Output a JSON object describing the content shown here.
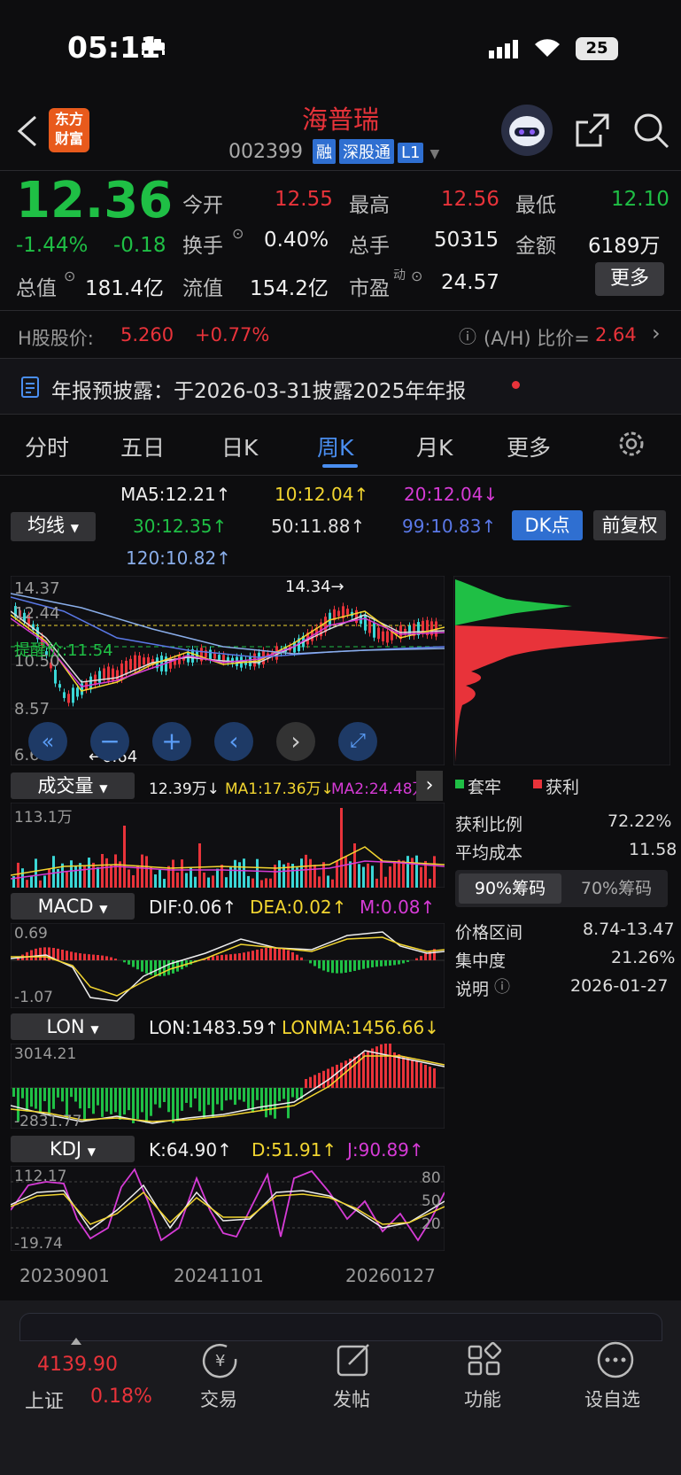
{
  "status": {
    "time": "05:11",
    "battery": "25"
  },
  "header": {
    "title": "海普瑞",
    "code": "002399",
    "tags": [
      "融",
      "深股通",
      "L1"
    ],
    "logo_text_1": "东方",
    "logo_text_2": "财富"
  },
  "quote": {
    "price": "12.36",
    "change_pct": "-1.44%",
    "change": "-0.18",
    "open_label": "今开",
    "open": "12.55",
    "high_label": "最高",
    "high": "12.56",
    "low_label": "最低",
    "low": "12.10",
    "turnover_label": "换手",
    "turnover": "0.40%",
    "volume_label": "总手",
    "volume": "50315",
    "amount_label": "金额",
    "amount": "6189万",
    "mktcap_label": "总值",
    "mktcap": "181.4亿",
    "float_label": "流值",
    "float": "154.2亿",
    "pe_label": "市盈",
    "pe_sup": "动",
    "pe": "24.57",
    "more": "更多"
  },
  "hshare": {
    "label": "H股股价:",
    "price": "5.260",
    "change": "+0.77%",
    "ratio_label": "(A/H) 比价=",
    "ratio": "2.64"
  },
  "notice": {
    "text": "年报预披露：于2026-03-31披露2025年年报"
  },
  "tabs": [
    "分时",
    "五日",
    "日K",
    "周K",
    "月K",
    "更多"
  ],
  "ma": {
    "ma5": "MA5:12.21↑",
    "ma10": "10:12.04↑",
    "ma20": "20:12.04↓",
    "ma30": "30:12.35↑",
    "ma50": "50:11.88↑",
    "ma99": "99:10.83↑",
    "ma120": "120:10.82↑",
    "selector": "均线",
    "dk": "DK点",
    "adjust": "前复权"
  },
  "kline": {
    "y_labels": [
      "14.37",
      "12.44",
      "10.50",
      "8.57",
      "6.64"
    ],
    "high_mark": "14.34→",
    "low_mark": "←6.64",
    "alert": "提醒价:11.54"
  },
  "chips": {
    "legend_hold": "套牢",
    "legend_profit": "获利",
    "rows": [
      {
        "label": "获利比例",
        "value": "72.22%"
      },
      {
        "label": "平均成本",
        "value": "11.58"
      }
    ],
    "tab90": "90%筹码",
    "tab70": "70%筹码",
    "rows2": [
      {
        "label": "价格区间",
        "value": "8.74-13.47"
      },
      {
        "label": "集中度",
        "value": "21.26%"
      },
      {
        "label": "说明",
        "value": "2026-01-27"
      }
    ]
  },
  "volume": {
    "selector": "成交量",
    "v": "12.39万↓",
    "ma1": "MA1:17.36万↓",
    "ma2": "MA2:24.48万",
    "max": "113.1万"
  },
  "macd": {
    "selector": "MACD",
    "dif": "DIF:0.06↑",
    "dea": "DEA:0.02↑",
    "m": "M:0.08↑",
    "top": "0.69",
    "bottom": "-1.07"
  },
  "lon": {
    "selector": "LON",
    "lon": "LON:1483.59↑",
    "lonma": "LONMA:1456.66↓",
    "top": "3014.21",
    "bottom": "-2831.77"
  },
  "kdj": {
    "selector": "KDJ",
    "k": "K:64.90↑",
    "d": "D:51.91↑",
    "j": "J:90.89↑",
    "top": "112.17",
    "bottom": "-19.74",
    "r80": "80",
    "r50": "50",
    "r20": "20"
  },
  "dates": [
    "20230901",
    "20241101",
    "20260127"
  ],
  "nav": {
    "index_value": "4139.90",
    "index_name": "上证",
    "index_change": "0.18%",
    "trade": "交易",
    "post": "发帖",
    "func": "功能",
    "watch": "设自选"
  },
  "colors": {
    "up": "#e8333a",
    "down": "#1fbf45",
    "accent": "#4a8ef0"
  }
}
